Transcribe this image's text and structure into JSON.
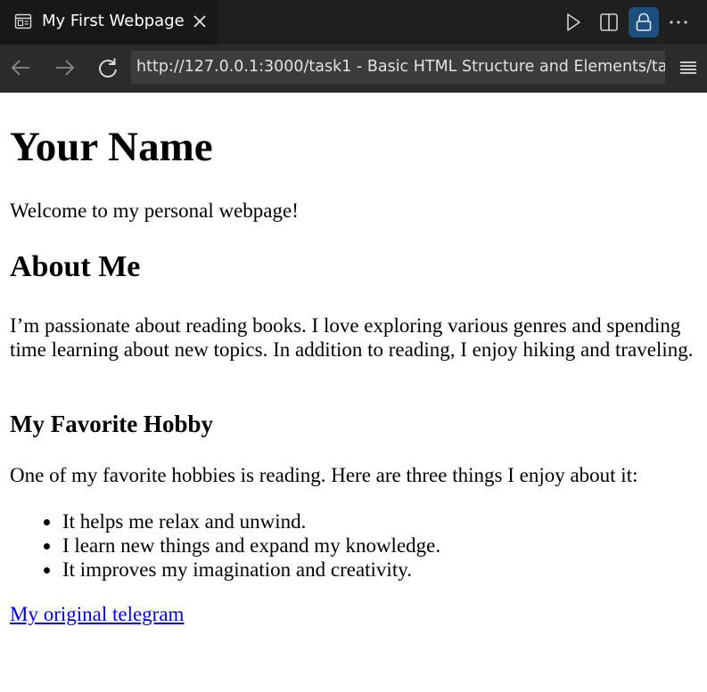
{
  "tab": {
    "title": "My First Webpage",
    "icon": "webpage-preview-icon",
    "close_icon": "close-icon"
  },
  "toolbar": {
    "icons": [
      "run-icon",
      "split-editor-icon",
      "lock-icon",
      "more-actions-icon"
    ],
    "lock_active_color": "#1d4f7e"
  },
  "nav": {
    "back_icon": "arrow-left-icon",
    "forward_icon": "arrow-right-icon",
    "reload_icon": "reload-icon",
    "url": "http://127.0.0.1:3000/task1 - Basic HTML Structure and Elements/ta",
    "menu_icon": "menu-icon"
  },
  "page": {
    "heading": "Your Name",
    "welcome": "Welcome to my personal webpage!",
    "about_heading": "About Me",
    "about_text": "I’m passionate about reading books. I love exploring various genres and spending time learning about new topics. In addition to reading, I enjoy hiking and traveling.",
    "hobby_heading": "My Favorite Hobby",
    "hobby_intro": "One of my favorite hobbies is reading. Here are three things I enjoy about it:",
    "hobby_items": [
      "It helps me relax and unwind.",
      "I learn new things and expand my knowledge.",
      "It improves my imagination and creativity."
    ],
    "link_text": "My original telegram",
    "link_color": "#0000ee"
  }
}
